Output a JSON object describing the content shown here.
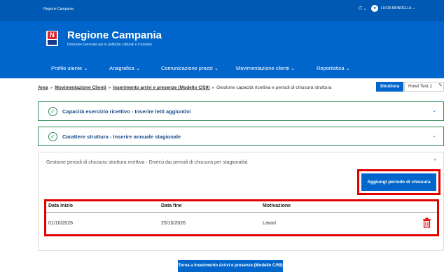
{
  "topbar": {
    "site_name": "Regione Campania",
    "language": "IT ⌄",
    "user_name": "LUCIA MONDELLA ⌄"
  },
  "header": {
    "title": "Regione Campania",
    "subtitle": "Direzione Generale per le politiche culturali e il turismo"
  },
  "nav": {
    "items": [
      {
        "label": "Profilo utente ⌄"
      },
      {
        "label": "Anagrafica ⌄"
      },
      {
        "label": "Comunicazione prezzi ⌄"
      },
      {
        "label": "Movimentazione clienti ⌄"
      },
      {
        "label": "Reportistica ⌄"
      }
    ]
  },
  "breadcrumb": {
    "items": [
      {
        "label": "Area"
      },
      {
        "label": "Movimentazione Clienti"
      },
      {
        "label": "Inserimento arrivi e presenze (Modello C/59)"
      }
    ],
    "current": "Gestione capacità ricettiva e periodi di chiusura struttura",
    "separator": "»"
  },
  "structure": {
    "tab_label": "Struttura",
    "hotel_name": "Hotel Test 1"
  },
  "accordions": [
    {
      "title": "Capacità esercizio ricettivo - Inserire letti aggiuntivi"
    },
    {
      "title": "Carattere struttura - Inserire annuale stagionale"
    }
  ],
  "panel": {
    "title": "Gestione periodi di chiusura struttura ricettiva - Diversi dai periodi di chiusura per stagionalità",
    "add_button": "Aggiungi periodo di chiusura",
    "table": {
      "headers": [
        "Data inizio",
        "Data fine",
        "Motivazione"
      ],
      "rows": [
        {
          "start": "01/10/2026",
          "end": "25/10/2026",
          "reason": "Lavori"
        }
      ]
    }
  },
  "footer": {
    "back_button": "Torna a Inserimento Arrivi e presenze (Modello C/59)"
  },
  "colors": {
    "primary": "#0066cc",
    "topbar": "#0059b3",
    "success": "#2e8b57",
    "highlight": "#e00000"
  },
  "icons": [
    "user-icon",
    "check-circle-icon",
    "chevron-down-icon",
    "chevron-up-icon",
    "pencil-icon",
    "trash-icon"
  ]
}
